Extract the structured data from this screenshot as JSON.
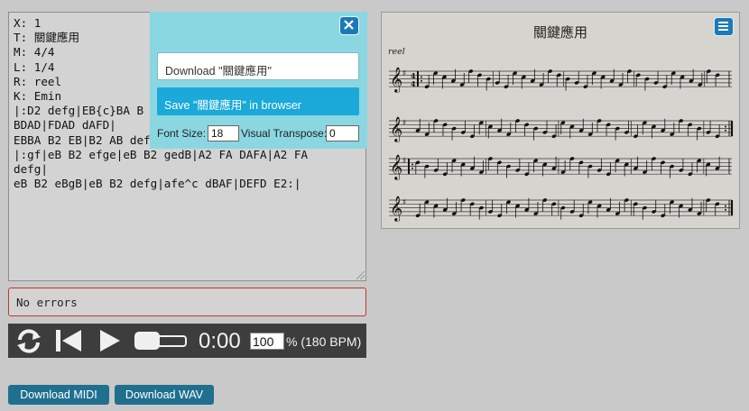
{
  "editor": {
    "lines": [
      "X: 1",
      "T: 關鍵應用",
      "M: 4/4",
      "L: 1/4",
      "R: reel",
      "K: Emin",
      "|:D2 defg|EB{c}BA B",
      "BDAD|FDAD dAFD|",
      "EBBA B2 EB|B2 AB defg|afe^c dBAF|DEFD E2:|",
      "|:gf|eB B2 efge|eB B2 gedB|A2 FA DAFA|A2 FA",
      "defg|",
      "eB B2 eBgB|eB B2 defg|afe^c dBAF|DEFD E2:|"
    ]
  },
  "errors": {
    "text": "No errors"
  },
  "player": {
    "time": "0:00",
    "tempo_value": "100",
    "tempo_label": "% (180 BPM)",
    "icons": [
      "restart-icon",
      "skip-back-icon",
      "play-icon",
      "progress-slider"
    ]
  },
  "popup": {
    "download_label": "Download \"關鍵應用\"",
    "save_label": "Save \"關鍵應用\" in browser",
    "font_size_label": "Font Size:",
    "font_size_value": "18",
    "transpose_label": "Visual Transpose:",
    "transpose_value": "0",
    "icons": [
      "close-icon"
    ]
  },
  "sheet": {
    "title": "關鍵應用",
    "tempo_marking": "reel",
    "icons": [
      "menu-icon"
    ]
  },
  "buttons": {
    "midi": "Download MIDI",
    "wav": "Download WAV"
  },
  "colors": {
    "page_bg": "#c9c9c9",
    "player_bg": "#3d3d3d",
    "popup_bg": "#8ad7e2",
    "accent": "#1b7ab6",
    "save_bg": "#1aa9d9",
    "error_border": "#c0392b"
  }
}
